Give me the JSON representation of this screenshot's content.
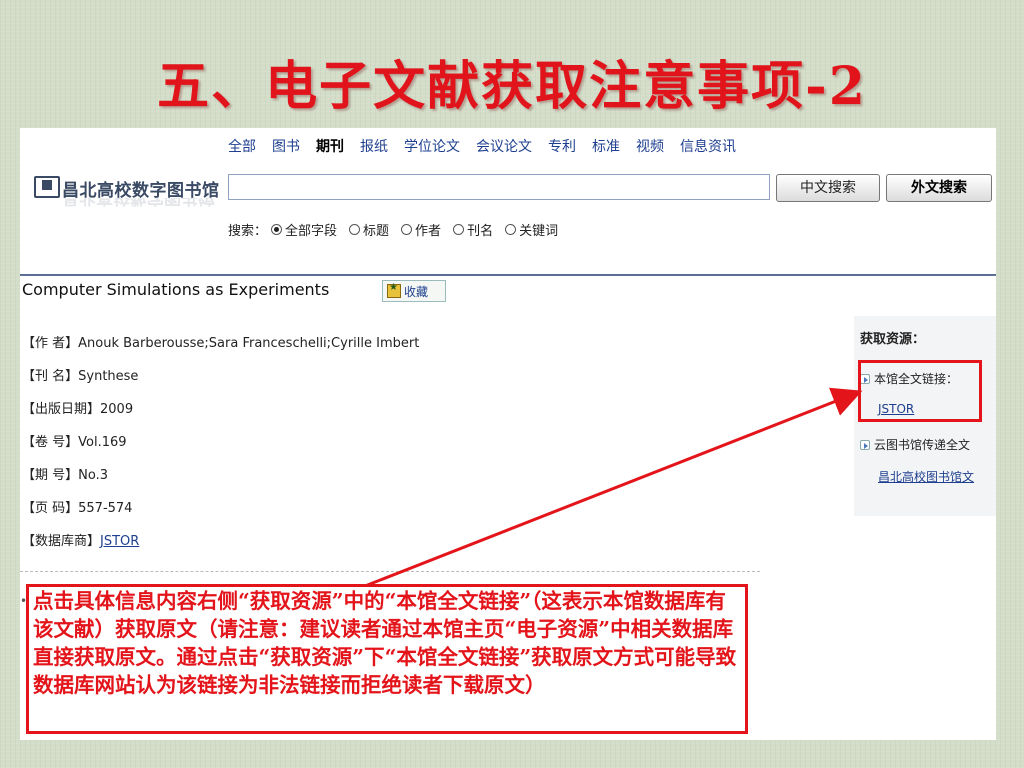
{
  "slide": {
    "title": "五、电子文献获取注意事项-2",
    "colors": {
      "title": "#e0141a",
      "annotation": "#e3151b",
      "background": "#d3ddc8"
    }
  },
  "header": {
    "logo_text": "昌北高校数字图书馆",
    "nav": [
      "全部",
      "图书",
      "期刊",
      "报纸",
      "学位论文",
      "会议论文",
      "专利",
      "标准",
      "视频",
      "信息资讯"
    ],
    "nav_active": "期刊",
    "search": {
      "value": "",
      "placeholder": ""
    },
    "buttons": {
      "chinese_search": "中文搜索",
      "foreign_search": "外文搜索"
    },
    "search_label": "搜索：",
    "search_fields": [
      {
        "label": "全部字段",
        "checked": true
      },
      {
        "label": "标题",
        "checked": false
      },
      {
        "label": "作者",
        "checked": false
      },
      {
        "label": "刊名",
        "checked": false
      },
      {
        "label": "关键词",
        "checked": false
      }
    ]
  },
  "article": {
    "title": "Computer Simulations as Experiments",
    "favorite_label": "收藏",
    "meta": [
      {
        "key": "【作  者】",
        "value": "Anouk Barberousse;Sara Franceschelli;Cyrille Imbert"
      },
      {
        "key": "【刊  名】",
        "value": "Synthese"
      },
      {
        "key": "【出版日期】",
        "value": "2009"
      },
      {
        "key": "【卷  号】",
        "value": "Vol.169"
      },
      {
        "key": "【期  号】",
        "value": "No.3"
      },
      {
        "key": "【页  码】",
        "value": "557-574"
      },
      {
        "key": "【数据库商】",
        "value": "JSTOR",
        "link": true
      }
    ]
  },
  "side_panel": {
    "title": "获取资源：",
    "items": [
      {
        "label": "本馆全文链接：",
        "link": "JSTOR"
      },
      {
        "label": "云图书馆传递全文",
        "link": "昌北高校图书馆文"
      }
    ]
  },
  "annotation": {
    "text": "点击具体信息内容右侧“获取资源”中的“本馆全文链接”（这表示本馆数据库有该文献）获取原文（请注意：建议读者通过本馆主页“电子资源”中相关数据库直接获取原文。通过点击“获取资源”下“本馆全文链接”获取原文方式可能导致数据库网站认为该链接为非法链接而拒绝读者下载原文）"
  }
}
